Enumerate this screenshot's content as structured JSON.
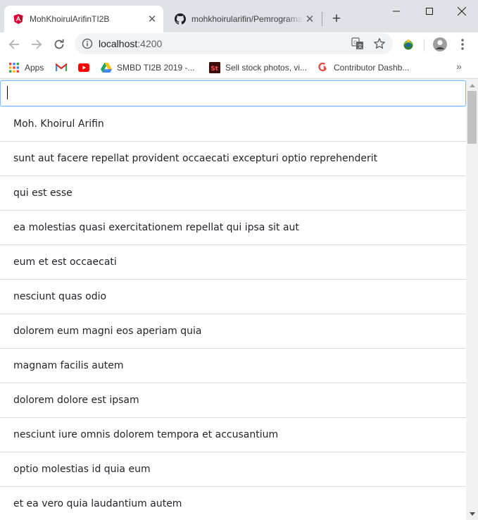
{
  "tabs": [
    {
      "title": "MohKhoirulArifinTI2B",
      "icon": "angular-icon",
      "active": true
    },
    {
      "title": "mohkhoirularifin/Pemrograman",
      "icon": "github-icon",
      "active": false
    }
  ],
  "toolbar": {
    "url_host": "localhost",
    "url_port": ":4200"
  },
  "bookmarks": [
    {
      "label": "Apps",
      "icon": "apps-grid-icon"
    },
    {
      "label": "",
      "icon": "gmail-icon"
    },
    {
      "label": "",
      "icon": "youtube-icon"
    },
    {
      "label": "SMBD TI2B 2019 -...",
      "icon": "google-drive-icon"
    },
    {
      "label": "Sell stock photos, vi...",
      "icon": "adobe-stock-icon"
    },
    {
      "label": "Contributor Dashb...",
      "icon": "contributor-icon"
    }
  ],
  "search": {
    "value": "",
    "placeholder": ""
  },
  "items": [
    "Moh. Khoirul Arifin",
    "sunt aut facere repellat provident occaecati excepturi optio reprehenderit",
    "qui est esse",
    "ea molestias quasi exercitationem repellat qui ipsa sit aut",
    "eum et est occaecati",
    "nesciunt quas odio",
    "dolorem eum magni eos aperiam quia",
    "magnam facilis autem",
    "dolorem dolore est ipsam",
    "nesciunt iure omnis dolorem tempora et accusantium",
    "optio molestias id quia eum",
    "et ea vero quia laudantium autem"
  ],
  "colors": {
    "tabstrip_bg": "#dee1e6",
    "focus_border": "#80bdff",
    "divider": "#dcdcdc",
    "angular_red": "#dd0031",
    "youtube_red": "#ff0000"
  }
}
